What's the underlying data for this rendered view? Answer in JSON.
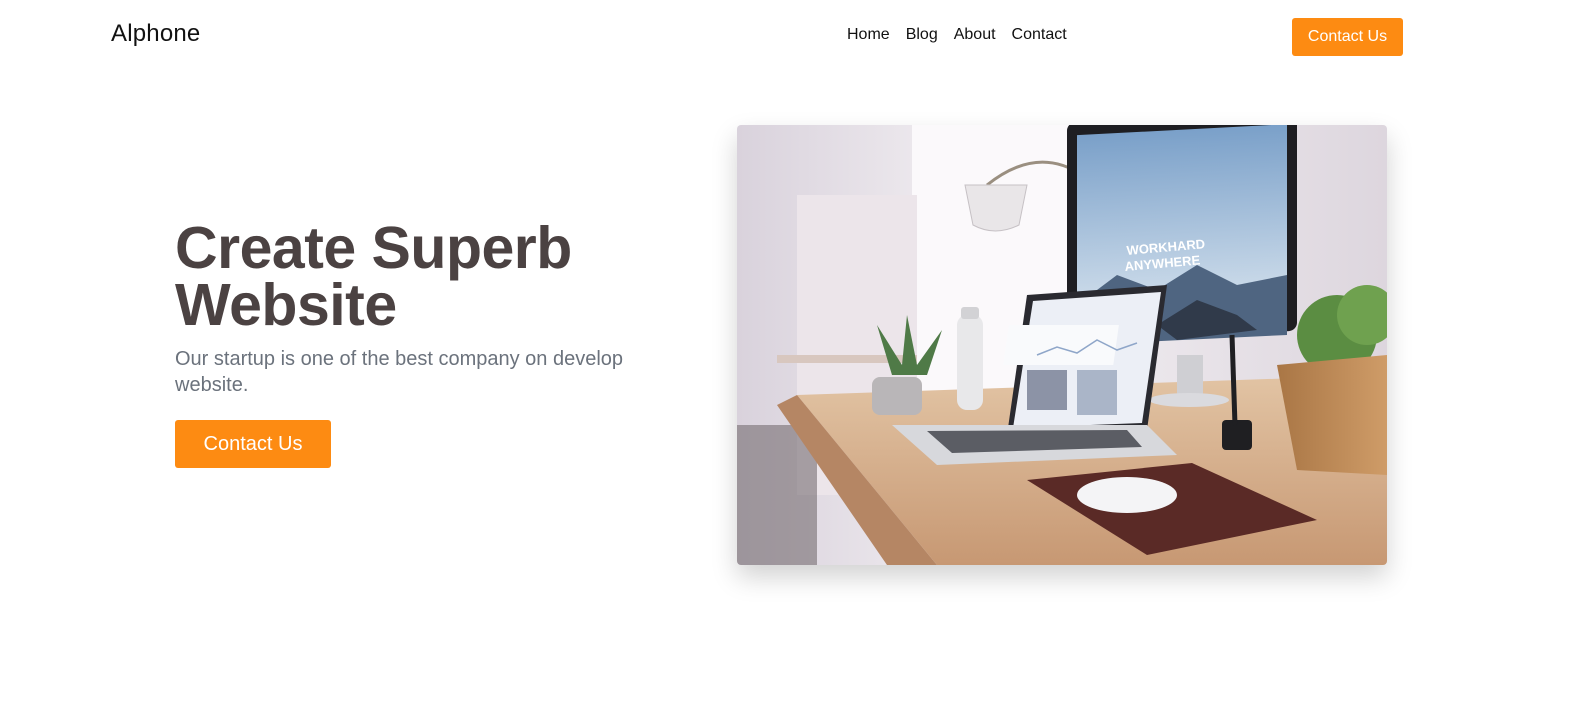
{
  "header": {
    "brand": "Alphone",
    "nav": [
      "Home",
      "Blog",
      "About",
      "Contact"
    ],
    "cta_label": "Contact Us"
  },
  "hero": {
    "title_line1": "Create Superb",
    "title_line2": "Website",
    "subtitle": "Our startup is one of the best company on develop website.",
    "cta_label": "Contact Us",
    "screen_text_line1": "WORKHARD",
    "screen_text_line2": "ANYWHERE"
  },
  "colors": {
    "accent": "#fd8b12",
    "title": "#4b4242",
    "subtitle": "#6b727c"
  }
}
